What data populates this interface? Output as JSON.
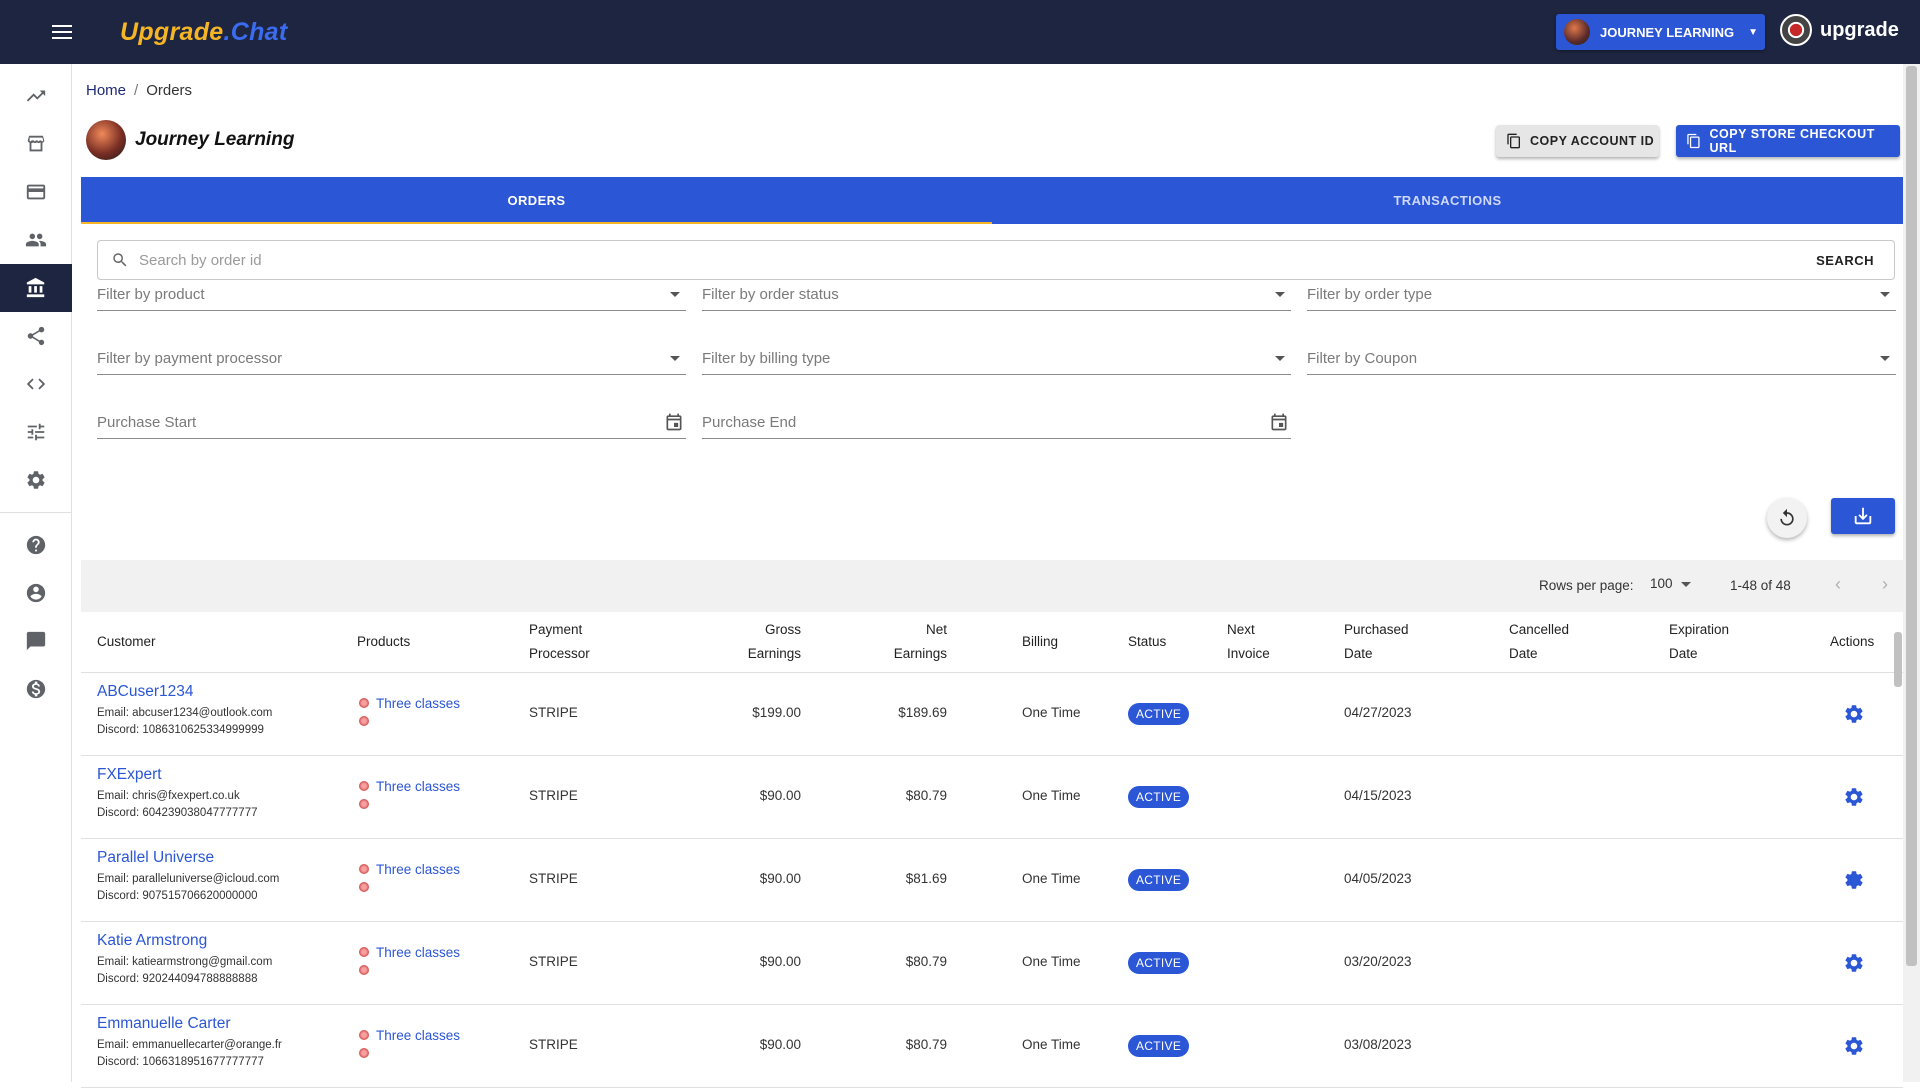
{
  "app": {
    "logo_part1": "Upgrade",
    "logo_part2": ".Chat",
    "account_button": "JOURNEY LEARNING",
    "user_label": "upgrade"
  },
  "breadcrumb": {
    "home": "Home",
    "current": "Orders",
    "sep": "/"
  },
  "store": {
    "name": "Journey Learning",
    "copy_account_id": "COPY ACCOUNT ID",
    "copy_checkout_url": "COPY STORE CHECKOUT URL"
  },
  "tabs": [
    {
      "label": "ORDERS",
      "active": true
    },
    {
      "label": "TRANSACTIONS",
      "active": false
    }
  ],
  "search": {
    "placeholder": "Search by order id",
    "value": "",
    "button": "SEARCH"
  },
  "filters": {
    "product": "Filter by product",
    "order_status": "Filter by order status",
    "order_type": "Filter by order type",
    "payment_processor": "Filter by payment processor",
    "billing_type": "Filter by billing type",
    "coupon": "Filter by Coupon",
    "purchase_start": "Purchase Start",
    "purchase_end": "Purchase End"
  },
  "pagination": {
    "rows_per_page_label": "Rows per page:",
    "rows_per_page": "100",
    "range": "1-48 of 48"
  },
  "columns": {
    "customer": "Customer",
    "products": "Products",
    "payment_1": "Payment",
    "payment_2": "Processor",
    "gross_1": "Gross",
    "gross_2": "Earnings",
    "net_1": "Net",
    "net_2": "Earnings",
    "billing": "Billing",
    "status": "Status",
    "next_1": "Next",
    "next_2": "Invoice",
    "purchased_1": "Purchased",
    "purchased_2": "Date",
    "cancelled_1": "Cancelled",
    "cancelled_2": "Date",
    "expiration_1": "Expiration",
    "expiration_2": "Date",
    "actions": "Actions"
  },
  "orders": [
    {
      "customer": "ABCuser1234",
      "email": "Email: abcuser1234@outlook.com",
      "discord": "Discord: 1086310625334999999",
      "product": "Three classes",
      "processor": "STRIPE",
      "gross": "$199.00",
      "net": "$189.69",
      "billing": "One Time",
      "status": "ACTIVE",
      "purchased": "04/27/2023"
    },
    {
      "customer": "FXExpert",
      "email": "Email: chris@fxexpert.co.uk",
      "discord": "Discord: 604239038047777777",
      "product": "Three classes",
      "processor": "STRIPE",
      "gross": "$90.00",
      "net": "$80.79",
      "billing": "One Time",
      "status": "ACTIVE",
      "purchased": "04/15/2023"
    },
    {
      "customer": "Parallel Universe",
      "email": "Email: paralleluniverse@icloud.com",
      "discord": "Discord: 907515706620000000",
      "product": "Three classes",
      "processor": "STRIPE",
      "gross": "$90.00",
      "net": "$81.69",
      "billing": "One Time",
      "status": "ACTIVE",
      "purchased": "04/05/2023"
    },
    {
      "customer": "Katie Armstrong",
      "email": "Email: katiearmstrong@gmail.com",
      "discord": "Discord: 920244094788888888",
      "product": "Three classes",
      "processor": "STRIPE",
      "gross": "$90.00",
      "net": "$80.79",
      "billing": "One Time",
      "status": "ACTIVE",
      "purchased": "03/20/2023"
    },
    {
      "customer": "Emmanuelle Carter",
      "email": "Email: emmanuellecarter@orange.fr",
      "discord": "Discord: 1066318951677777777",
      "product": "Three classes",
      "processor": "STRIPE",
      "gross": "$90.00",
      "net": "$80.79",
      "billing": "One Time",
      "status": "ACTIVE",
      "purchased": "03/08/2023"
    }
  ],
  "icons": {
    "sidebar": [
      "trending-up-icon",
      "storefront-icon",
      "credit-card-icon",
      "people-icon",
      "bank-icon",
      "share-icon",
      "code-icon",
      "tune-icon",
      "settings-icon",
      "help-icon",
      "account-circle-icon",
      "chat-icon",
      "dollar-icon"
    ]
  },
  "colors": {
    "topbar": "#1d2540",
    "accent": "#2b56d5",
    "tab_indicator": "#f5b524",
    "logo_yellow": "#f5b524"
  }
}
